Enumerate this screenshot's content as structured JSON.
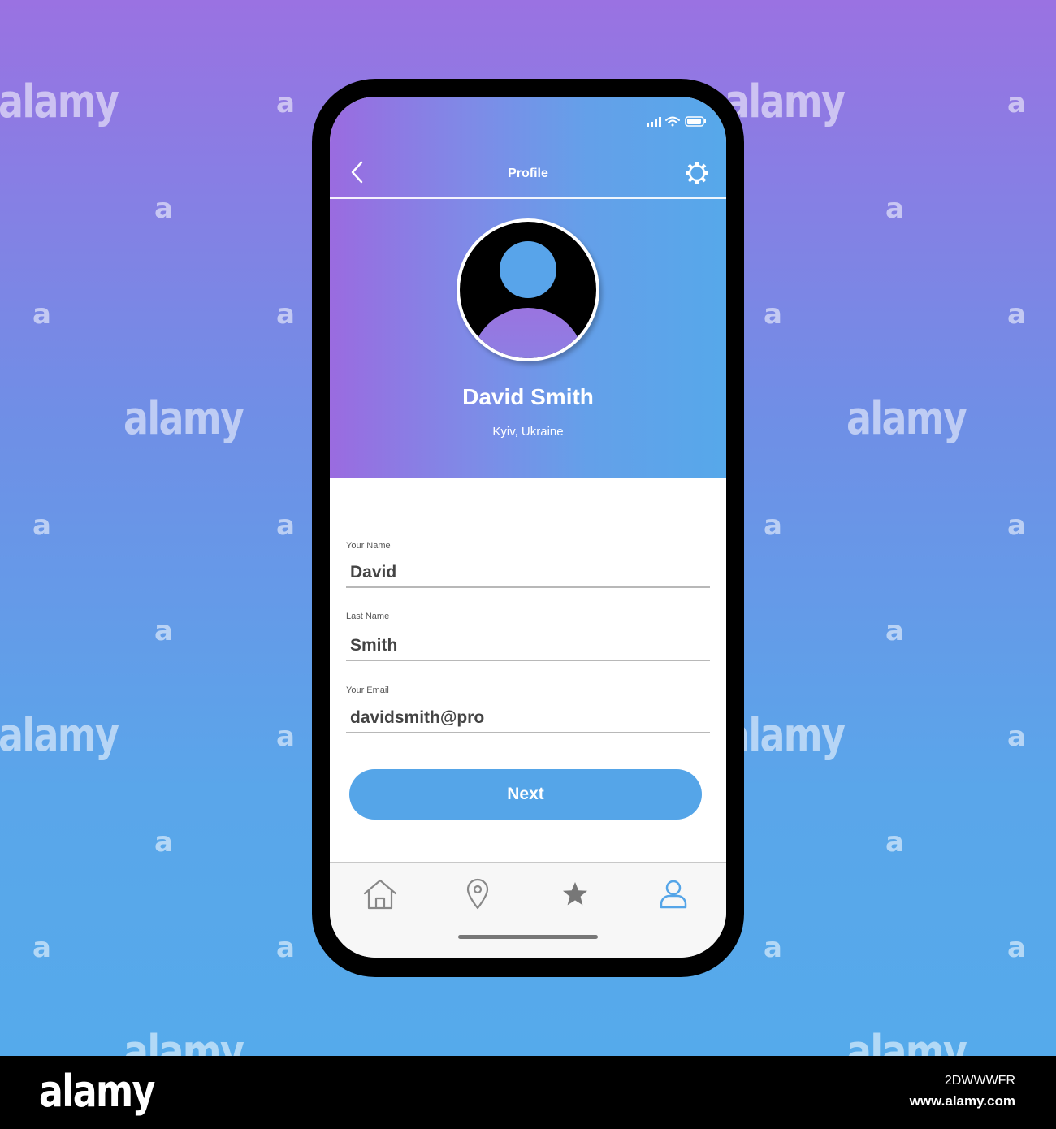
{
  "watermark": {
    "word": "alamy",
    "letter": "a"
  },
  "status_bar": {
    "icons": [
      "signal-icon",
      "wifi-icon",
      "battery-icon"
    ]
  },
  "header": {
    "title": "Profile",
    "back_icon": "chevron-left-icon",
    "settings_icon": "gear-icon"
  },
  "profile": {
    "name": "David Smith",
    "location": "Kyiv, Ukraine"
  },
  "form": {
    "fields": [
      {
        "label": "Your Name",
        "value": "David"
      },
      {
        "label": "Last Name",
        "value": "Smith"
      },
      {
        "label": "Your Email",
        "value": "davidsmith@pro"
      }
    ],
    "submit_label": "Next"
  },
  "bottom_nav": {
    "items": [
      {
        "icon": "home-icon",
        "active": false
      },
      {
        "icon": "location-pin-icon",
        "active": false
      },
      {
        "icon": "star-icon",
        "active": false
      },
      {
        "icon": "user-icon",
        "active": true
      }
    ]
  },
  "colors": {
    "accent": "#55a5e8",
    "gradient_start": "#9a6be0",
    "gradient_end": "#56a8ea"
  },
  "footer": {
    "logo": "alamy",
    "image_id": "2DWWWFR",
    "url": "www.alamy.com"
  }
}
